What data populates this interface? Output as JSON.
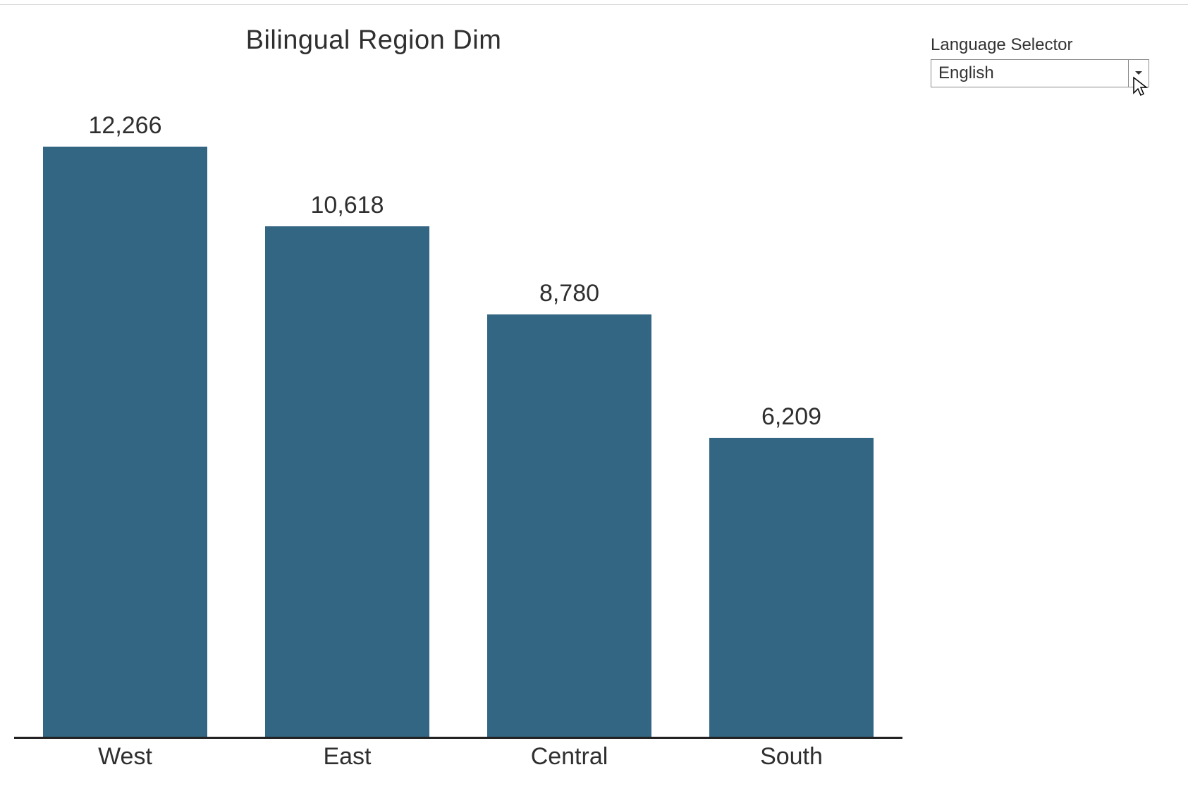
{
  "title": "Bilingual Region Dim",
  "selector": {
    "label": "Language Selector",
    "value": "English"
  },
  "colors": {
    "bar": "#336683"
  },
  "chart_data": {
    "type": "bar",
    "title": "Bilingual Region Dim",
    "xlabel": "",
    "ylabel": "",
    "categories": [
      "West",
      "East",
      "Central",
      "South"
    ],
    "values": [
      12266,
      10618,
      8780,
      6209
    ],
    "value_labels": [
      "12,266",
      "10,618",
      "8,780",
      "6,209"
    ],
    "ylim": [
      0,
      13000
    ]
  }
}
